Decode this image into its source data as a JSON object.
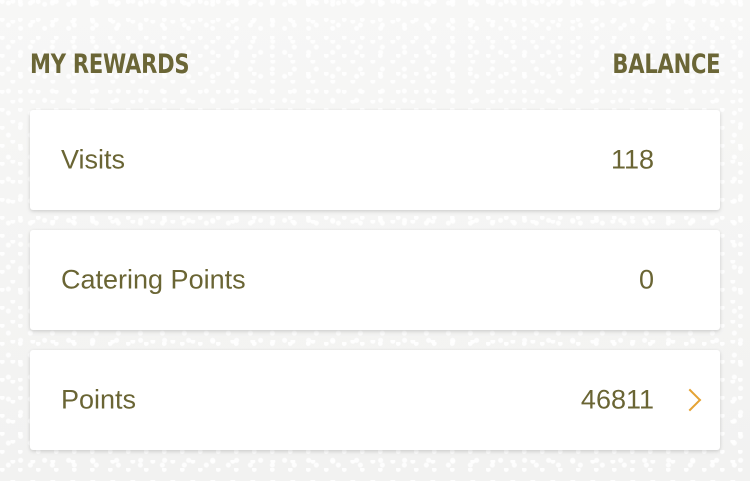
{
  "header": {
    "title": "MY REWARDS",
    "balance_label": "BALANCE"
  },
  "rewards": [
    {
      "label": "Visits",
      "value": "118"
    },
    {
      "label": "Catering Points",
      "value": "0"
    },
    {
      "label": "Points",
      "value": "46811",
      "icon": "chevron-right-icon"
    }
  ],
  "colors": {
    "text": "#6a6534",
    "accent": "#e5a334",
    "card": "#ffffff"
  }
}
